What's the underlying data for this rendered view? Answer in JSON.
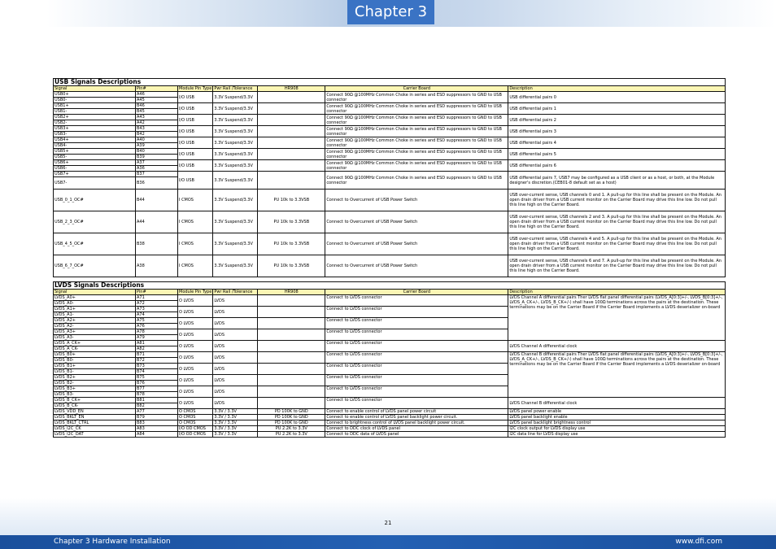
{
  "header": {
    "chapter_label": "Chapter 3"
  },
  "usb": {
    "title": "USB Signals Descriptions",
    "columns": [
      "Signal",
      "Pin#",
      "Module Pin Type",
      "Pwr Rail /Tolerance",
      "HR908",
      "Carrier Board",
      "Description"
    ],
    "rows": [
      {
        "sig1": "USB0+",
        "pin1": "A46",
        "sig2": "USB0-",
        "pin2": "A45",
        "type": "I/O USB",
        "pwr": "3.3V Suspend/3.3V",
        "hr": "",
        "carrier": "Connect 90Ω @100MHz Common Choke in series and ESD suppressors to GND to USB connector",
        "desc": "USB differential pairs 0"
      },
      {
        "sig1": "USB1+",
        "pin1": "B46",
        "sig2": "USB1-",
        "pin2": "B45",
        "type": "I/O USB",
        "pwr": "3.3V Suspend/3.3V",
        "hr": "",
        "carrier": "Connect 90Ω @100MHz Common Choke in series and ESD suppressors to GND to USB connector",
        "desc": "USB differential pairs 1"
      },
      {
        "sig1": "USB2+",
        "pin1": "A43",
        "sig2": "USB2-",
        "pin2": "A42",
        "type": "I/O USB",
        "pwr": "3.3V Suspend/3.3V",
        "hr": "",
        "carrier": "Connect 90Ω @100MHz Common Choke in series and ESD suppressors to GND to USB connector",
        "desc": "USB differential pairs 2"
      },
      {
        "sig1": "USB3+",
        "pin1": "B43",
        "sig2": "USB3-",
        "pin2": "B42",
        "type": "I/O USB",
        "pwr": "3.3V Suspend/3.3V",
        "hr": "",
        "carrier": "Connect 90Ω @100MHz Common Choke in series and ESD suppressors to GND to USB connector",
        "desc": "USB differential pairs 3"
      },
      {
        "sig1": "USB4+",
        "pin1": "A40",
        "sig2": "USB4-",
        "pin2": "A39",
        "type": "I/O USB",
        "pwr": "3.3V Suspend/3.3V",
        "hr": "",
        "carrier": "Connect 90Ω @100MHz Common Choke in series and ESD suppressors to GND to USB connector",
        "desc": "USB differential pairs 4"
      },
      {
        "sig1": "USB5+",
        "pin1": "B40",
        "sig2": "USB5-",
        "pin2": "B39",
        "type": "I/O USB",
        "pwr": "3.3V Suspend/3.3V",
        "hr": "",
        "carrier": "Connect 90Ω @100MHz Common Choke in series and ESD suppressors to GND to USB connector",
        "desc": "USB differential pairs 5"
      },
      {
        "sig1": "USB6+",
        "pin1": "A37",
        "sig2": "USB6-",
        "pin2": "A36",
        "type": "I/O USB",
        "pwr": "3.3V Suspend/3.3V",
        "hr": "",
        "carrier": "Connect 90Ω @100MHz Common Choke in series and ESD suppressors to GND to USB connector",
        "desc": "USB differential pairs 6"
      },
      {
        "sig1": "USB7+",
        "pin1": "B37",
        "sig2": "USB7-",
        "pin2": "B36",
        "type": "I/O USB",
        "pwr": "3.3V Suspend/3.3V",
        "hr": "",
        "carrier": "Connect 90Ω @100MHz Common Choke in series and ESD suppressors to GND to USB connector",
        "desc": "USB differential pairs 7, USB7 may be configured as a USB client or as a host, or both, at the Module designer's discretion.(CEB01-8 default set as a host)"
      }
    ],
    "oc_rows": [
      {
        "sig": "USB_0_1_OC#",
        "pin": "B44",
        "type": "I CMOS",
        "pwr": "3.3V Suspend/3.3V",
        "hr": "PU 10k to 3.3VSB",
        "carrier": "Connect to Overcurrent of USB Power Switch",
        "desc": "USB over-current sense, USB channels 0 and 1. A pull-up for this line shall be present on the Module. An open drain driver from a USB current monitor on the Carrier Board may drive this line low. Do not pull this line high on the Carrier Board."
      },
      {
        "sig": "USB_2_3_OC#",
        "pin": "A44",
        "type": "I CMOS",
        "pwr": "3.3V Suspend/3.3V",
        "hr": "PU 10k to 3.3VSB",
        "carrier": "Connect to Overcurrent of USB Power Switch",
        "desc": "USB over-current sense, USB channels 2 and 3. A pull-up for this line shall be present on the Module. An open drain driver from a USB current monitor on the Carrier Board may drive this line low. Do not pull this line high on the Carrier Board."
      },
      {
        "sig": "USB_4_5_OC#",
        "pin": "B38",
        "type": "I CMOS",
        "pwr": "3.3V Suspend/3.3V",
        "hr": "PU 10k to 3.3VSB",
        "carrier": "Connect to Overcurrent of USB Power Switch",
        "desc": "USB over-current sense, USB channels 4 and 5. A pull-up for this line shall be present on the Module. An open drain driver from a USB current monitor on the Carrier Board may drive this line low. Do not pull this line high on the Carrier Board."
      },
      {
        "sig": "USB_6_7_OC#",
        "pin": "A38",
        "type": "I CMOS",
        "pwr": "3.3V Suspend/3.3V",
        "hr": "PU 10k to 3.3VSB",
        "carrier": "Connect to Overcurrent of USB Power Switch",
        "desc": "USB over-current sense, USB channels 6 and 7. A pull-up for this line shall be present on the Module. An open drain driver from a USB current monitor on the Carrier Board may drive this line low. Do not pull this line high on the Carrier Board."
      }
    ]
  },
  "lvds": {
    "title": "LVDS Signals Descriptions",
    "columns": [
      "Signal",
      "Pin#",
      "Module Pin Type",
      "Pwr Rail /Tolerance",
      "HR908",
      "Carrier Board",
      "Description"
    ],
    "pairs": [
      {
        "sig1": "LVDS_A0+",
        "pin1": "A71",
        "sig2": "LVDS_A0-",
        "pin2": "A72",
        "type": "O LVDS",
        "pwr": "LVDS",
        "carrier": "Connect to LVDS connector"
      },
      {
        "sig1": "LVDS_A1+",
        "pin1": "A73",
        "sig2": "LVDS_A1-",
        "pin2": "A74",
        "type": "O LVDS",
        "pwr": "LVDS",
        "carrier": "Connect to LVDS connector"
      },
      {
        "sig1": "LVDS_A2+",
        "pin1": "A75",
        "sig2": "LVDS_A2-",
        "pin2": "A76",
        "type": "O LVDS",
        "pwr": "LVDS",
        "carrier": "Connect to LVDS connector"
      },
      {
        "sig1": "LVDS_A3+",
        "pin1": "A78",
        "sig2": "LVDS_A3-",
        "pin2": "A79",
        "type": "O LVDS",
        "pwr": "LVDS",
        "carrier": "Connect to LVDS connector"
      },
      {
        "sig1": "LVDS_A_CK+",
        "pin1": "A81",
        "sig2": "LVDS_A_CK-",
        "pin2": "A82",
        "type": "O LVDS",
        "pwr": "LVDS",
        "carrier": "Connect to LVDS connector"
      },
      {
        "sig1": "LVDS_B0+",
        "pin1": "B71",
        "sig2": "LVDS_B0-",
        "pin2": "B72",
        "type": "O LVDS",
        "pwr": "LVDS",
        "carrier": "Connect to LVDS connector"
      },
      {
        "sig1": "LVDS_B1+",
        "pin1": "B73",
        "sig2": "LVDS_B1-",
        "pin2": "B74",
        "type": "O LVDS",
        "pwr": "LVDS",
        "carrier": "Connect to LVDS connector"
      },
      {
        "sig1": "LVDS_B2+",
        "pin1": "B75",
        "sig2": "LVDS_B2-",
        "pin2": "B76",
        "type": "O LVDS",
        "pwr": "LVDS",
        "carrier": "Connect to LVDS connector"
      },
      {
        "sig1": "LVDS_B3+",
        "pin1": "B77",
        "sig2": "LVDS_B3-",
        "pin2": "B78",
        "type": "O LVDS",
        "pwr": "LVDS",
        "carrier": "Connect to LVDS connector"
      },
      {
        "sig1": "LVDS_B_CK+",
        "pin1": "B81",
        "sig2": "LVDS_B_CK-",
        "pin2": "B82",
        "type": "O LVDS",
        "pwr": "LVDS",
        "carrier": "Connect to LVDS connector"
      }
    ],
    "desc_a": "LVDS Channel A differential pairs Ther LVDS flat panel differential pairs (LVDS_A[0:3]+/-, LVDS_B[0:3]+/-, LVDS_A_CK+/-, LVDS_B_CK+/-) shall have 100Ω terminations across the pairs at the destination. These terminations may be on the Carrier Board if the Carrier Board implements a LVDS deserializer on-board",
    "desc_a_clk": "LVDS Channel A differential clock",
    "desc_b": "LVDS Channel B differential pairs Ther LVDS flat panel differential pairs (LVDS_A[0:3]+/-, LVDS_B[0:3]+/-, LVDS_A_CK+/-, LVDS_B_CK+/-) shall have 100Ω terminations across the pairs at the destination. These terminations may be on the Carrier Board if the Carrier Board implements a LVDS deserializer on-board",
    "desc_b_clk": "LVDS Channel B differential clock",
    "ctrl_rows": [
      {
        "sig": "LVDS_VDD_EN",
        "pin": "A77",
        "type": "O CMOS",
        "pwr": "3.3V / 3.3V",
        "hr": "PD 100K to GND",
        "carrier": "Connect to enable control of LVDS panel power circuit",
        "desc": "LVDS panel power enable"
      },
      {
        "sig": "LVDS_BKLT_EN",
        "pin": "B79",
        "type": "O CMOS",
        "pwr": "3.3V / 3.3V",
        "hr": "PD 100K to GND",
        "carrier": "Connect to enable control of LVDS panel backlight power circuit.",
        "desc": "LVDS panel backlight enable"
      },
      {
        "sig": "LVDS_BKLT_CTRL",
        "pin": "B83",
        "type": "O CMOS",
        "pwr": "3.3V / 3.3V",
        "hr": "PD 100K to GND",
        "carrier": "Connect to brightness control of LVDS panel backlight power circuit.",
        "desc": "LVDS panel backlight brightness control"
      },
      {
        "sig": "LVDS_I2C_CK",
        "pin": "A83",
        "type": "I/O OD CMOS",
        "pwr": "3.3V / 3.3V",
        "hr": "PU 2.2K to 3.3V",
        "carrier": "Connect to DDC clock of LVDS panel",
        "desc": "I2C clock output for LVDS display use"
      },
      {
        "sig": "LVDS_I2C_DAT",
        "pin": "A84",
        "type": "I/O OD CMOS",
        "pwr": "3.3V / 3.3V",
        "hr": "PU 2.2K to 3.3V",
        "carrier": "Connect to DDC data of LVDS panel",
        "desc": "I2C data line for LVDS display use"
      }
    ]
  },
  "page_number": "21",
  "footer": {
    "left": "Chapter 3 Hardware Installation",
    "right": "www.dfi.com"
  }
}
